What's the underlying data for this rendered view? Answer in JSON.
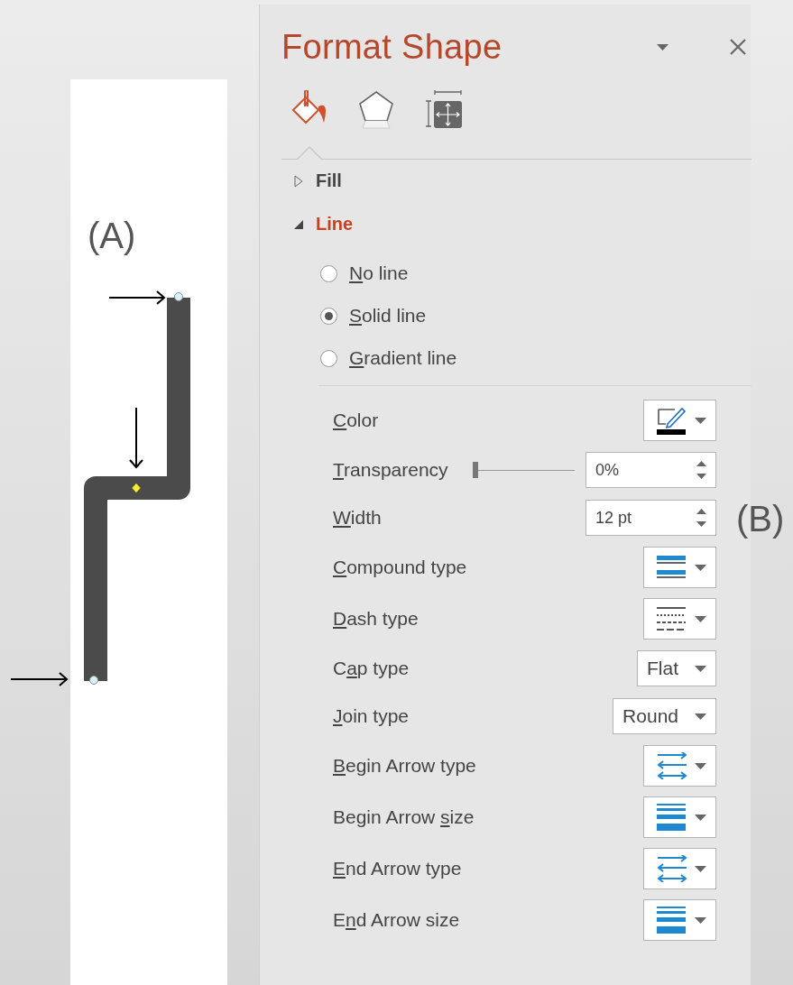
{
  "canvas": {
    "label": "(A)"
  },
  "side_label": "(B)",
  "panel": {
    "title": "Format Shape",
    "tabs": [
      {
        "selected": true
      },
      {
        "selected": false
      },
      {
        "selected": false
      }
    ],
    "sections": [
      {
        "label": "Fill",
        "expanded": false
      },
      {
        "label": "Line",
        "expanded": true
      }
    ],
    "line_options": [
      {
        "key": "N",
        "post": "o line",
        "selected": false
      },
      {
        "key": "S",
        "post": "olid line",
        "selected": true
      },
      {
        "key": "G",
        "post": "radient line",
        "selected": false
      }
    ],
    "properties": [
      {
        "kind": "color",
        "key": "C",
        "post": "olor"
      },
      {
        "kind": "slider",
        "key": "T",
        "post": "ransparency",
        "level": 0,
        "value": "0%"
      },
      {
        "kind": "spinner",
        "key": "W",
        "post": "idth",
        "value": "12 pt"
      },
      {
        "kind": "compound",
        "key": "C",
        "post": "ompound type"
      },
      {
        "kind": "dash",
        "key": "D",
        "post": "ash type"
      },
      {
        "kind": "dropdown",
        "pre": "C",
        "key": "a",
        "post": "p type",
        "value": "Flat"
      },
      {
        "kind": "dropdown",
        "key": "J",
        "post": "oin type",
        "value": "Round"
      },
      {
        "kind": "arrow-type",
        "key": "B",
        "post": "egin Arrow type"
      },
      {
        "kind": "arrow-size",
        "pre": "Begin Arrow ",
        "key": "s",
        "post": "ize"
      },
      {
        "kind": "arrow-type",
        "key": "E",
        "post": "nd Arrow type"
      },
      {
        "kind": "arrow-size",
        "pre": "E",
        "key": "n",
        "post": "d Arrow size"
      }
    ]
  }
}
